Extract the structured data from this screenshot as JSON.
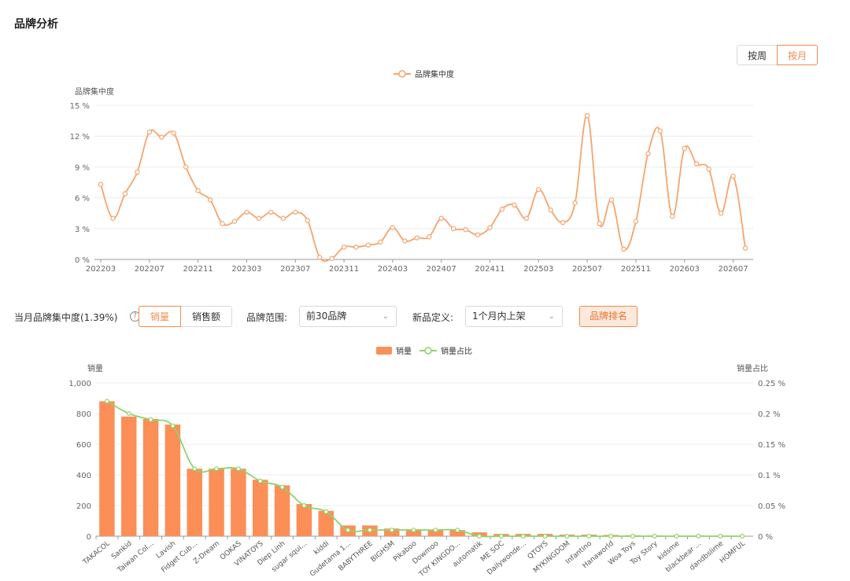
{
  "page_title": "品牌分析",
  "period_toggle": {
    "week_label": "按周",
    "month_label": "按月",
    "active": "month"
  },
  "controls": {
    "concentration_label": "当月品牌集中度(1.39%)",
    "metric_tabs": [
      "销量",
      "销售额"
    ],
    "active_metric": "销量",
    "brand_range_label": "品牌范围:",
    "brand_range_value": "前30品牌",
    "new_def_label": "新品定义:",
    "new_def_value": "1个月内上架",
    "rank_button": "品牌排名"
  },
  "colors": {
    "accent": "#f08c4f",
    "line_orange": "#f5a46e",
    "bar": "#fb8f57",
    "share_line": "#8fd36b",
    "grid": "#ececec"
  },
  "chart_data": [
    {
      "type": "line",
      "legend": [
        "品牌集中度"
      ],
      "legend_position": "top-center",
      "ylabel": "品牌集中度",
      "y_unit": "%",
      "ylim": [
        0,
        15
      ],
      "yticks": [
        0,
        3,
        6,
        9,
        12,
        15
      ],
      "ytick_labels": [
        "0 %",
        "3 %",
        "6 %",
        "9 %",
        "12 %",
        "15 %"
      ],
      "x": [
        "202203",
        "202204",
        "202205",
        "202206",
        "202207",
        "202208",
        "202209",
        "202210",
        "202211",
        "202212",
        "202301",
        "202302",
        "202303",
        "202304",
        "202305",
        "202306",
        "202307",
        "202308",
        "202309",
        "202310",
        "202311",
        "202312",
        "202401",
        "202402",
        "202403",
        "202404",
        "202405",
        "202406",
        "202407",
        "202408",
        "202409",
        "202410",
        "202411",
        "202412",
        "202501",
        "202502",
        "202503",
        "202504",
        "202505",
        "202506",
        "202507",
        "202508",
        "202509",
        "202510",
        "202511",
        "202512",
        "202601",
        "202602",
        "202603",
        "202604",
        "202605",
        "202606",
        "202607",
        "202608"
      ],
      "xtick_labels": [
        "202203",
        "202207",
        "202211",
        "202303",
        "202307",
        "202311",
        "202403",
        "202407",
        "202411",
        "202503",
        "202507",
        "202511",
        "202603",
        "202607"
      ],
      "series": [
        {
          "name": "品牌集中度",
          "values": [
            7.3,
            4.0,
            6.4,
            8.5,
            12.4,
            11.9,
            12.3,
            9.0,
            6.7,
            5.8,
            3.5,
            3.7,
            4.6,
            4.0,
            4.6,
            4.0,
            4.6,
            3.8,
            0.2,
            0.1,
            1.2,
            1.2,
            1.4,
            1.7,
            3.1,
            1.8,
            2.1,
            2.2,
            4.0,
            3.0,
            2.9,
            2.4,
            3.1,
            4.9,
            5.3,
            4.0,
            6.8,
            4.8,
            3.6,
            5.5,
            14.0,
            3.5,
            5.8,
            1.0,
            3.7,
            10.3,
            12.5,
            4.2,
            10.8,
            9.3,
            8.8,
            4.5,
            8.1,
            1.1
          ]
        }
      ],
      "grid": true
    },
    {
      "type": "bar",
      "legend": [
        "销量",
        "销量占比"
      ],
      "legend_position": "top-center",
      "ylabel": "销量",
      "ylabel_right": "销量占比",
      "ylim": [
        0,
        1000
      ],
      "yticks": [
        0,
        200,
        400,
        600,
        800,
        1000
      ],
      "ytick_labels": [
        "0",
        "200",
        "400",
        "600",
        "800",
        "1,000"
      ],
      "ylim_right": [
        0,
        0.25
      ],
      "yticks_right_labels": [
        "0 %",
        "0.05 %",
        "0.1 %",
        "0.15 %",
        "0.2 %",
        "0.25 %"
      ],
      "categories": [
        "TAKACOL",
        "Sankid",
        "Taiwan Col...",
        "Lavish",
        "Fidget Cub...",
        "Z-Dream",
        "OOKAS",
        "VINATOYS",
        "Diep Linh",
        "sugar squi...",
        "kiddi",
        "Gudetama 1...",
        "BABYTHREE",
        "BIGHSM",
        "Pikaboo",
        "Dowmoo",
        "TOY KINGDO...",
        "automatik",
        "ME SOC",
        "Dailywonde...",
        "QTOYS",
        "MYKINGDOM",
        "Infantino",
        "Hanaworld",
        "Woa Toys",
        "Toy Story",
        "kidsme",
        "blackbear ...",
        "dandbslime",
        "HOMFUL"
      ],
      "series": [
        {
          "name": "销量",
          "type": "bar",
          "values": [
            880,
            780,
            765,
            728,
            440,
            440,
            440,
            368,
            332,
            210,
            165,
            70,
            70,
            50,
            45,
            42,
            40,
            25,
            15,
            15,
            15,
            10,
            10,
            8,
            6,
            5,
            4,
            4,
            3,
            2
          ]
        },
        {
          "name": "销量占比",
          "type": "line",
          "axis": "right",
          "values": [
            0.22,
            0.2,
            0.19,
            0.18,
            0.11,
            0.11,
            0.11,
            0.09,
            0.08,
            0.05,
            0.04,
            0.01,
            0.01,
            0.01,
            0.01,
            0.01,
            0.01,
            0,
            0,
            0,
            0,
            0,
            0,
            0,
            0,
            0,
            0,
            0,
            0,
            0
          ]
        }
      ],
      "grid": true
    }
  ]
}
